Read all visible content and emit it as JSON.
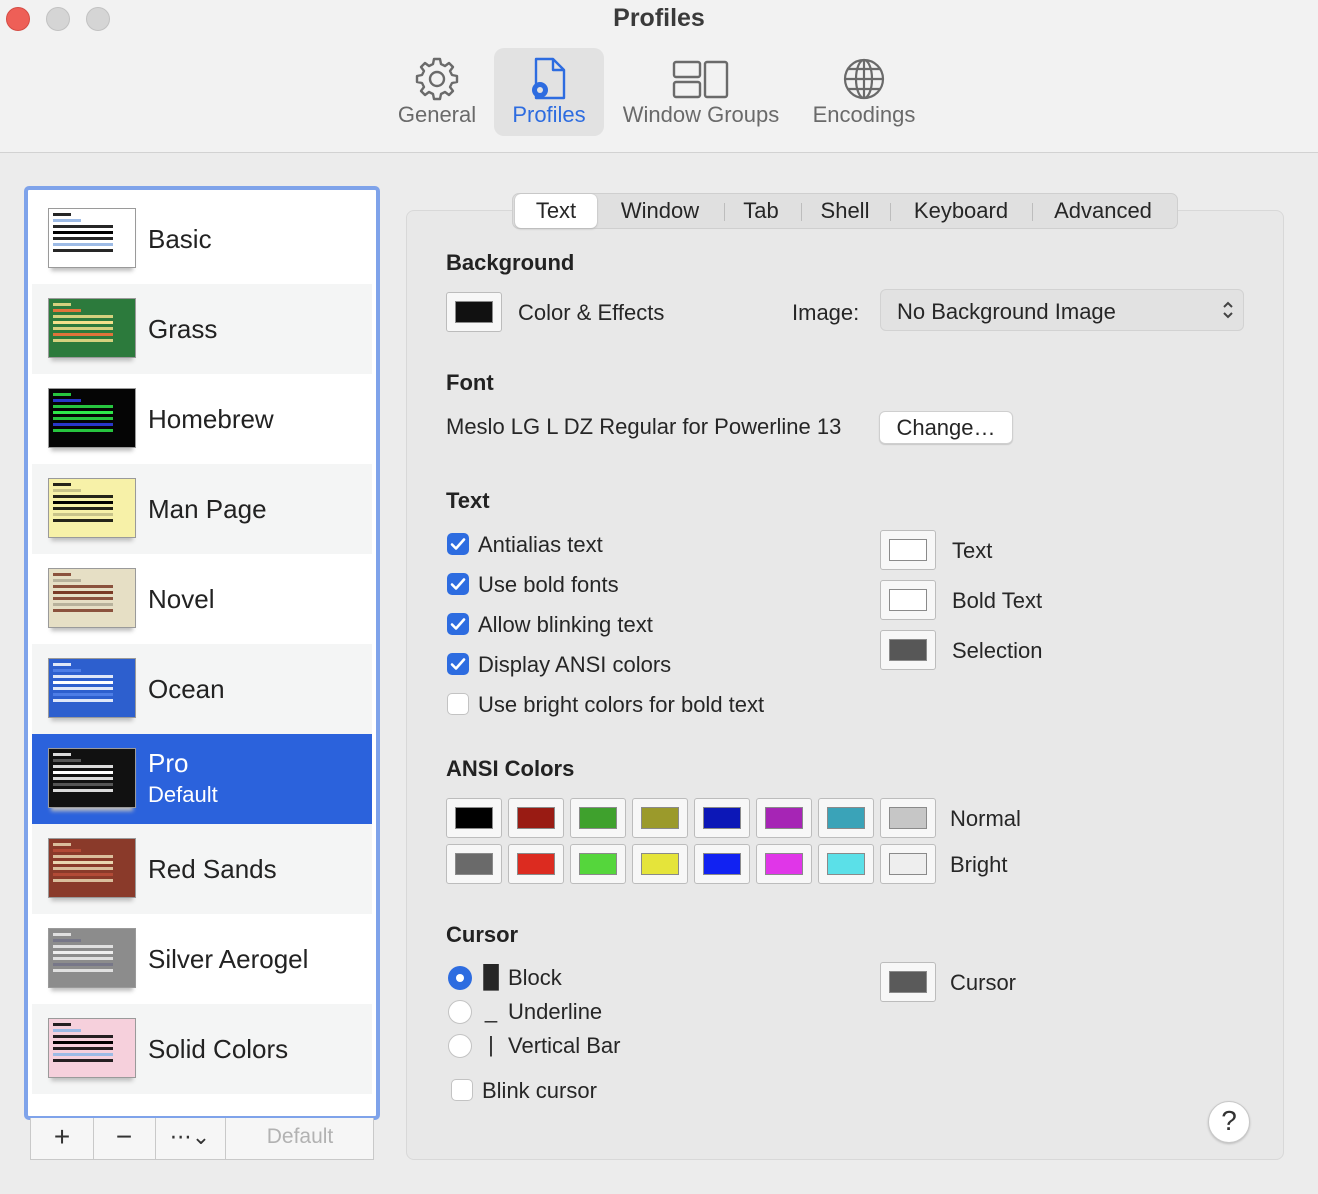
{
  "window": {
    "title": "Profiles"
  },
  "toolbar": {
    "items": [
      {
        "label": "General",
        "icon": "gear-icon"
      },
      {
        "label": "Profiles",
        "icon": "profile-doc-icon",
        "selected": true
      },
      {
        "label": "Window Groups",
        "icon": "window-groups-icon"
      },
      {
        "label": "Encodings",
        "icon": "globe-icon"
      }
    ]
  },
  "profiles": {
    "items": [
      {
        "name": "Basic",
        "bg": "#ffffff",
        "fg": "#000000",
        "hl": "#9dbbe6"
      },
      {
        "name": "Grass",
        "bg": "#2c7a3c",
        "fg": "#f3e08a",
        "hl": "#e0733a"
      },
      {
        "name": "Homebrew",
        "bg": "#050505",
        "fg": "#2ee84a",
        "hl": "#2837c8"
      },
      {
        "name": "Man Page",
        "bg": "#f7f1a8",
        "fg": "#000000",
        "hl": "#c9c48a"
      },
      {
        "name": "Novel",
        "bg": "#e6dfc5",
        "fg": "#7a3a25",
        "hl": "#b8b29c"
      },
      {
        "name": "Ocean",
        "bg": "#2d5fce",
        "fg": "#ffffff",
        "hl": "#4d7de6"
      },
      {
        "name": "Pro",
        "subtitle": "Default",
        "bg": "#111111",
        "fg": "#ffffff",
        "hl": "#555555",
        "selected": true
      },
      {
        "name": "Red Sands",
        "bg": "#8a3a2a",
        "fg": "#e8d6b0",
        "hl": "#b24a36"
      },
      {
        "name": "Silver Aerogel",
        "bg": "#8c8c8c",
        "fg": "#eeeeee",
        "hl": "#777788"
      },
      {
        "name": "Solid Colors",
        "bg": "#f6d0dc",
        "fg": "#000000",
        "hl": "#9dbbe6"
      }
    ],
    "buttons": {
      "add": "+",
      "remove": "−",
      "more": "⋯⌄",
      "default": "Default"
    }
  },
  "tabs": [
    "Text",
    "Window",
    "Tab",
    "Shell",
    "Keyboard",
    "Advanced"
  ],
  "background": {
    "heading": "Background",
    "color_label": "Color & Effects",
    "color": "#111111",
    "image_label": "Image:",
    "image_value": "No Background Image"
  },
  "font": {
    "heading": "Font",
    "name": "Meslo LG L DZ Regular for Powerline 13",
    "change_label": "Change…"
  },
  "text": {
    "heading": "Text",
    "checkboxes": [
      {
        "label": "Antialias text",
        "checked": true
      },
      {
        "label": "Use bold fonts",
        "checked": true
      },
      {
        "label": "Allow blinking text",
        "checked": true
      },
      {
        "label": "Display ANSI colors",
        "checked": true
      },
      {
        "label": "Use bright colors for bold text",
        "checked": false
      }
    ],
    "colors": [
      {
        "label": "Text",
        "color": "#ffffff"
      },
      {
        "label": "Bold Text",
        "color": "#ffffff"
      },
      {
        "label": "Selection",
        "color": "#575757"
      }
    ]
  },
  "ansi": {
    "heading": "ANSI Colors",
    "normal_label": "Normal",
    "bright_label": "Bright",
    "normal": [
      "#000000",
      "#991b13",
      "#3fa12d",
      "#9b9a2b",
      "#0c17b7",
      "#a625b5",
      "#3aa3b8",
      "#c6c6c6"
    ],
    "bright": [
      "#6a6a6a",
      "#dc2b20",
      "#55d63c",
      "#e5e43a",
      "#1122f2",
      "#e036e8",
      "#5be0e8",
      "#eeeeee"
    ]
  },
  "cursor": {
    "heading": "Cursor",
    "options": [
      {
        "glyph": "█",
        "label": "Block",
        "selected": true
      },
      {
        "glyph": "_",
        "label": "Underline",
        "selected": false
      },
      {
        "glyph": "|",
        "label": "Vertical Bar",
        "selected": false
      }
    ],
    "blink_label": "Blink cursor",
    "blink": false,
    "color_label": "Cursor",
    "color": "#5a5a5a"
  },
  "help": "?"
}
